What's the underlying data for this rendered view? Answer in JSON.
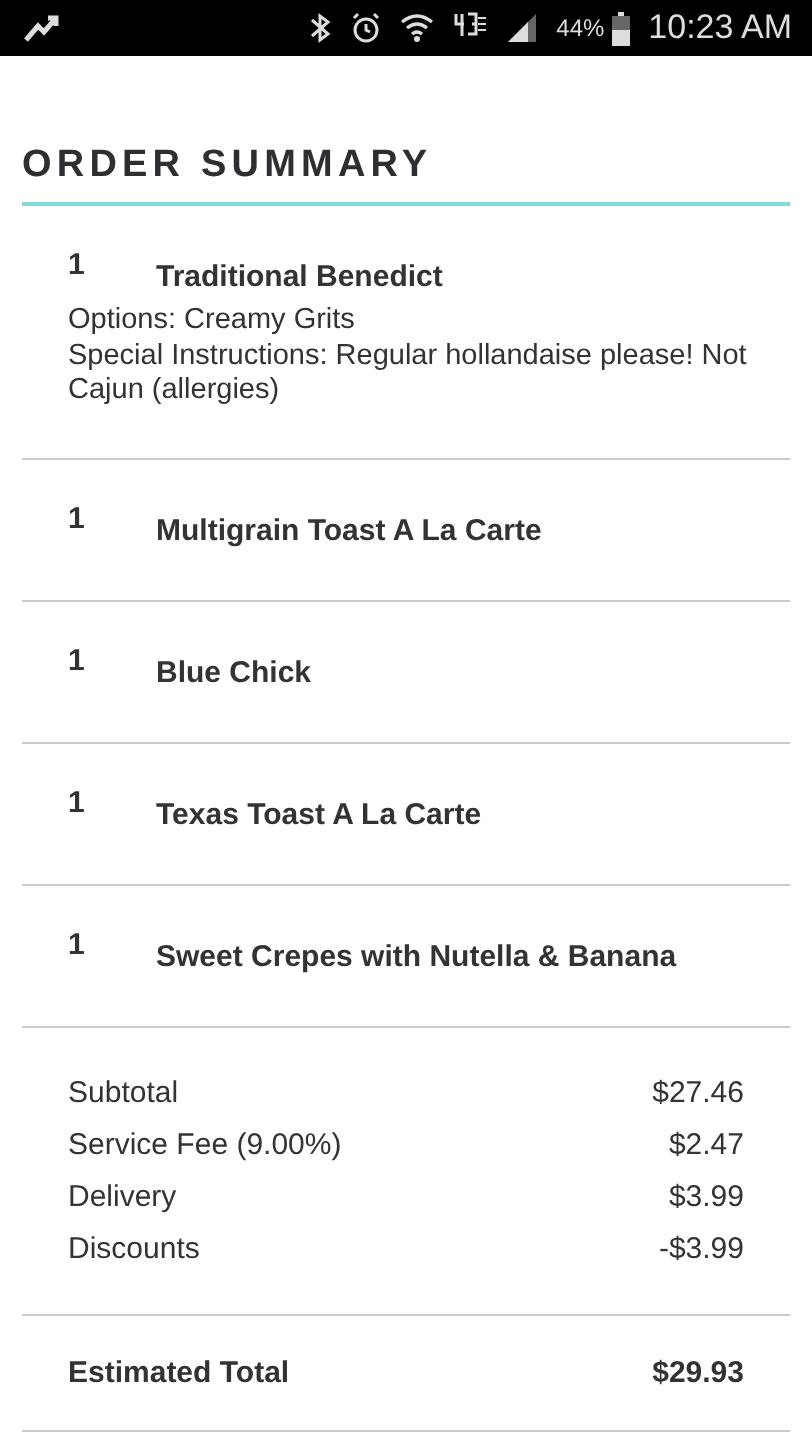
{
  "status_bar": {
    "battery": "44%",
    "time": "10:23 AM"
  },
  "title": "ORDER SUMMARY",
  "items": [
    {
      "quantity": "1",
      "name": "Traditional Benedict",
      "notes": [
        "Options: Creamy Grits",
        "Special Instructions: Regular hollandaise please! Not Cajun (allergies)"
      ]
    },
    {
      "quantity": "1",
      "name": "Multigrain Toast A La Carte"
    },
    {
      "quantity": "1",
      "name": "Blue Chick"
    },
    {
      "quantity": "1",
      "name": "Texas Toast A La Carte"
    },
    {
      "quantity": "1",
      "name": "Sweet Crepes with Nutella & Banana"
    }
  ],
  "charges": [
    {
      "label": "Subtotal",
      "amount": "$27.46"
    },
    {
      "label": "Service Fee (9.00%)",
      "amount": "$2.47"
    },
    {
      "label": "Delivery",
      "amount": "$3.99"
    },
    {
      "label": "Discounts",
      "amount": "-$3.99"
    }
  ],
  "total": {
    "label": "Estimated Total",
    "amount": "$29.93"
  }
}
